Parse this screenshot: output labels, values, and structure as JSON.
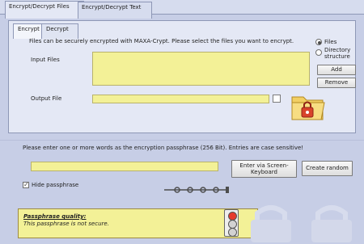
{
  "tabs": [
    "Encrypt/Decrypt Files",
    "Encrypt/Decrypt Text"
  ],
  "subtabs": [
    "Encrypt",
    "Decrypt"
  ],
  "encrypt_panel": {
    "instruction": "Files can be securely encrypted with MAXA-Crypt. Please select the files you want to encrypt.",
    "input_files_label": "Input Files",
    "output_file_label": "Output File",
    "radio_files": "Files",
    "radio_directory": "Directory structure",
    "add_button": "Add",
    "remove_button": "Remove"
  },
  "passphrase": {
    "instruction": "Please enter one or more words as the encryption passphrase (256 Bit). Entries are case sensitive!",
    "screen_keyboard_button": "Enter via Screen-Keyboard",
    "create_random_button": "Create random",
    "hide_label": "Hide passphrase",
    "hide_checked": true
  },
  "quality": {
    "title": "Passphrase quality:",
    "message": "This passphrase is not secure.",
    "traffic_light_state": "red"
  },
  "colors": {
    "yellow_field": "#f3f197",
    "panel": "#e4e8f5",
    "background": "#c7cee6",
    "lock_red": "#d8432b"
  },
  "icons": [
    "folder-lock-icon",
    "key-icon",
    "padlock-watermark-icon"
  ]
}
